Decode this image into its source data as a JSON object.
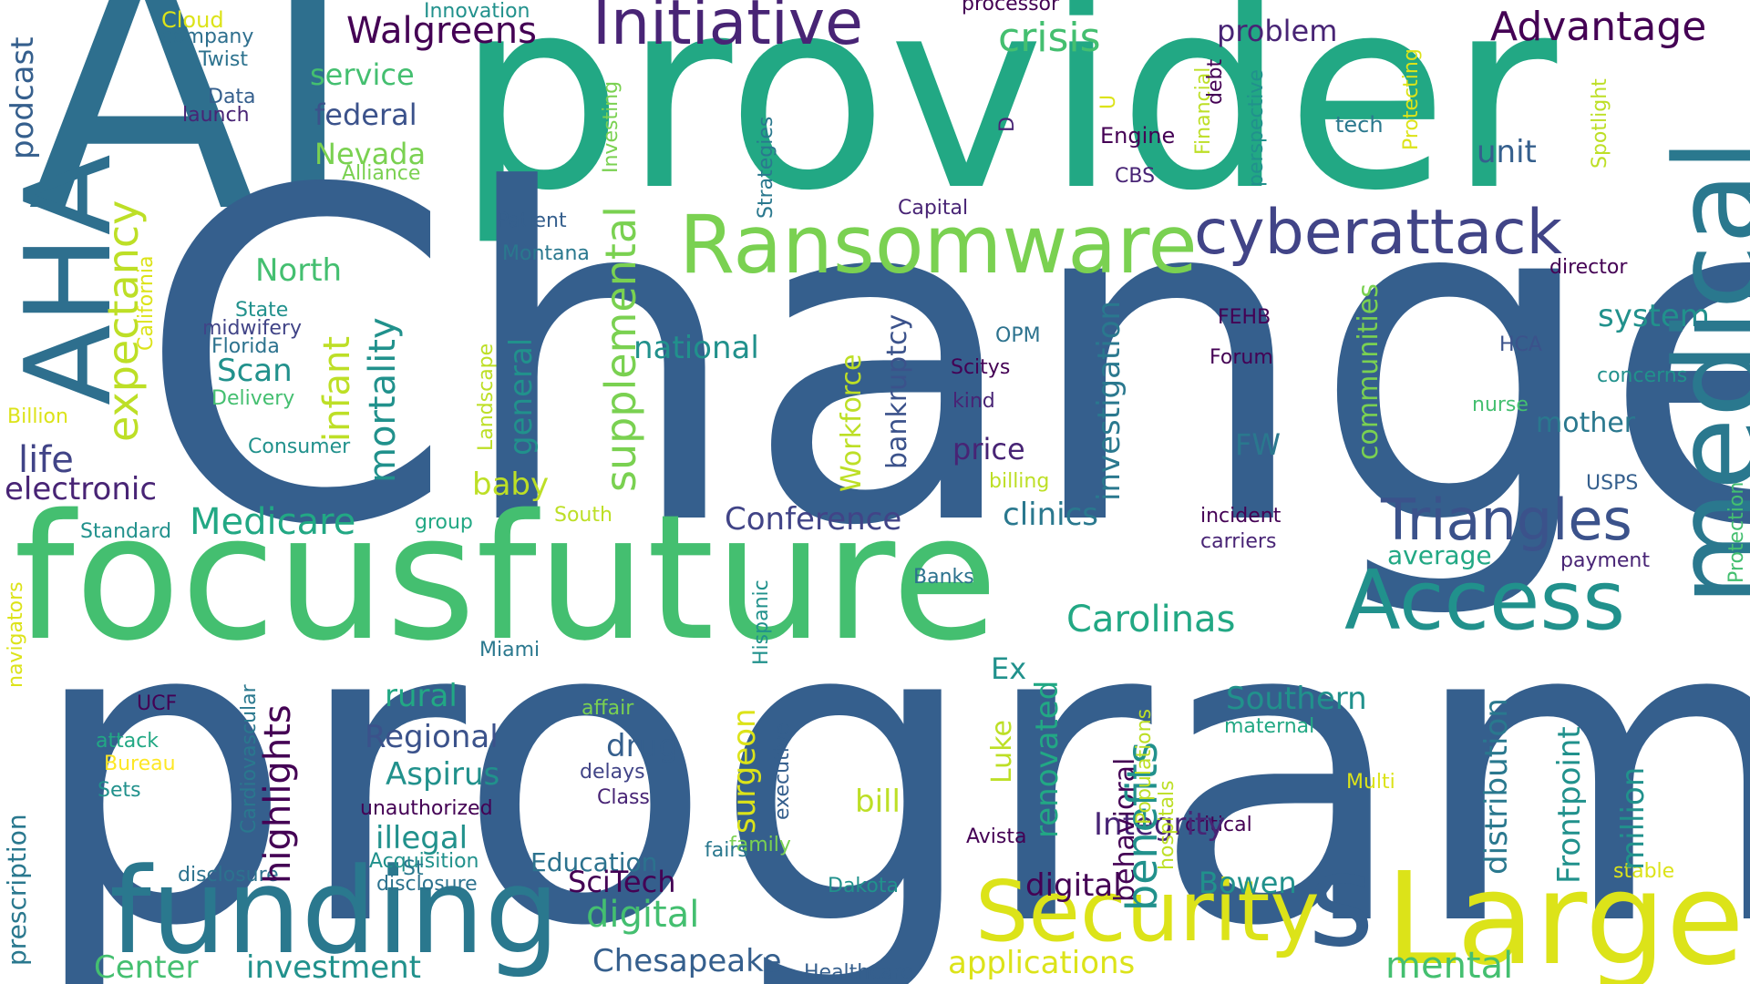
{
  "words": [
    {
      "text": "AI"
    },
    {
      "text": "provider"
    },
    {
      "text": "Change"
    },
    {
      "text": "focusfuture"
    },
    {
      "text": "program"
    },
    {
      "text": "Ransomware"
    },
    {
      "text": "cyberattack"
    },
    {
      "text": "Access"
    },
    {
      "text": "Triangles"
    },
    {
      "text": "s"
    },
    {
      "text": "Security"
    },
    {
      "text": "Large"
    },
    {
      "text": "funding"
    },
    {
      "text": "Initiative"
    },
    {
      "text": "Walgreens"
    },
    {
      "text": "Advantage"
    },
    {
      "text": "crisis"
    },
    {
      "text": "problem"
    },
    {
      "text": "service"
    },
    {
      "text": "federal"
    },
    {
      "text": "Nevada"
    },
    {
      "text": "Alliance"
    },
    {
      "text": "Innovation"
    },
    {
      "text": "processor"
    },
    {
      "text": "Cloud"
    },
    {
      "text": "company"
    },
    {
      "text": "Twist"
    },
    {
      "text": "Data"
    },
    {
      "text": "launch"
    },
    {
      "text": "unit"
    },
    {
      "text": "tech"
    },
    {
      "text": "Engine"
    },
    {
      "text": "CBS"
    },
    {
      "text": "Capital"
    },
    {
      "text": "director"
    },
    {
      "text": "Patient"
    },
    {
      "text": "Montana"
    },
    {
      "text": "North"
    },
    {
      "text": "State"
    },
    {
      "text": "midwifery"
    },
    {
      "text": "Florida"
    },
    {
      "text": "Scan"
    },
    {
      "text": "Delivery"
    },
    {
      "text": "Billion"
    },
    {
      "text": "Consumer"
    },
    {
      "text": "FEHB"
    },
    {
      "text": "Forum"
    },
    {
      "text": "OPM"
    },
    {
      "text": "Scitys"
    },
    {
      "text": "kind"
    },
    {
      "text": "HCA"
    },
    {
      "text": "system"
    },
    {
      "text": "concerns"
    },
    {
      "text": "nurse"
    },
    {
      "text": "mother"
    },
    {
      "text": "national"
    },
    {
      "text": "life"
    },
    {
      "text": "electronic"
    },
    {
      "text": "price"
    },
    {
      "text": "FW"
    },
    {
      "text": "billing"
    },
    {
      "text": "baby"
    },
    {
      "text": "USPS"
    },
    {
      "text": "Medicare"
    },
    {
      "text": "group"
    },
    {
      "text": "clinics"
    },
    {
      "text": "incident"
    },
    {
      "text": "carriers"
    },
    {
      "text": "average"
    },
    {
      "text": "payment"
    },
    {
      "text": "Conference"
    },
    {
      "text": "Standard"
    },
    {
      "text": "South"
    },
    {
      "text": "Banks"
    },
    {
      "text": "Carolinas"
    },
    {
      "text": "Miami"
    },
    {
      "text": "Ex"
    },
    {
      "text": "rural"
    },
    {
      "text": "affair"
    },
    {
      "text": "Southern"
    },
    {
      "text": "maternal"
    },
    {
      "text": "UCF"
    },
    {
      "text": "Regional"
    },
    {
      "text": "drug"
    },
    {
      "text": "attack"
    },
    {
      "text": "Bureau"
    },
    {
      "text": "delays"
    },
    {
      "text": "Multi"
    },
    {
      "text": "Aspirus"
    },
    {
      "text": "Sets"
    },
    {
      "text": "unauthorized"
    },
    {
      "text": "Class"
    },
    {
      "text": "illegal"
    },
    {
      "text": "bill"
    },
    {
      "text": "Avista"
    },
    {
      "text": "critical"
    },
    {
      "text": "Acquisition"
    },
    {
      "text": "family"
    },
    {
      "text": "fairs"
    },
    {
      "text": "Integrity"
    },
    {
      "text": "St"
    },
    {
      "text": "Education"
    },
    {
      "text": "stable"
    },
    {
      "text": "disclosure"
    },
    {
      "text": "SciTech"
    },
    {
      "text": "Dakota"
    },
    {
      "text": "digital"
    },
    {
      "text": "Bowen"
    },
    {
      "text": "Chesapeake"
    },
    {
      "text": "Center"
    },
    {
      "text": "investment"
    },
    {
      "text": "Healthcare"
    },
    {
      "text": "applications"
    },
    {
      "text": "mental"
    },
    {
      "text": "Protection"
    },
    {
      "text": "podcast"
    },
    {
      "text": "AHA"
    },
    {
      "text": "expectancy"
    },
    {
      "text": "California"
    },
    {
      "text": "infant"
    },
    {
      "text": "mortality"
    },
    {
      "text": "Landscape"
    },
    {
      "text": "general"
    },
    {
      "text": "supplemental"
    },
    {
      "text": "Investing"
    },
    {
      "text": "Strategies"
    },
    {
      "text": "Workforce"
    },
    {
      "text": "bankruptcy"
    },
    {
      "text": "investigation"
    },
    {
      "text": "Financial"
    },
    {
      "text": "debt"
    },
    {
      "text": "perspective"
    },
    {
      "text": "communities"
    },
    {
      "text": "Protecting"
    },
    {
      "text": "Spotlight"
    },
    {
      "text": "medical"
    },
    {
      "text": "navigators"
    },
    {
      "text": "Cardiovascular"
    },
    {
      "text": "highlights"
    },
    {
      "text": "Hispanic"
    },
    {
      "text": "surgeon"
    },
    {
      "text": "executive"
    },
    {
      "text": "Luke"
    },
    {
      "text": "renovated"
    },
    {
      "text": "behavioral"
    },
    {
      "text": "benefits"
    },
    {
      "text": "Populations"
    },
    {
      "text": "hospitals"
    },
    {
      "text": "distribution"
    },
    {
      "text": "Frontpoint"
    },
    {
      "text": "million"
    },
    {
      "text": "D"
    },
    {
      "text": "prescription"
    },
    {
      "text": "U"
    }
  ]
}
